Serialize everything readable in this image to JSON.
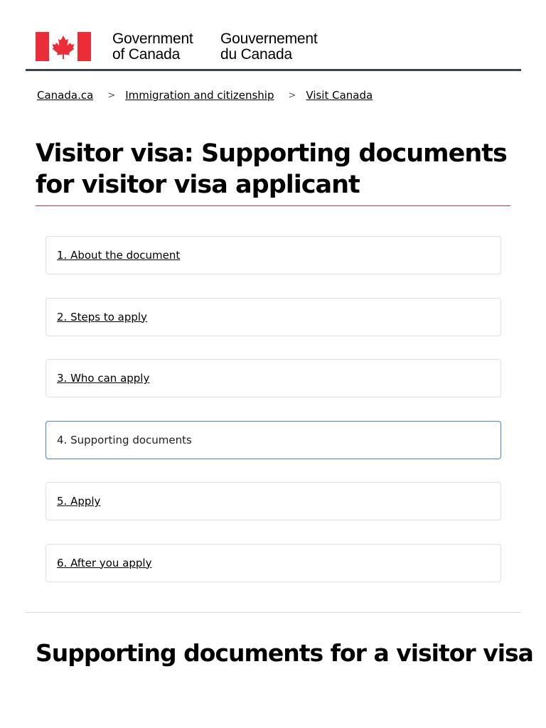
{
  "header": {
    "flag_icon": "canada-flag-icon",
    "signature_en_line1": "Government",
    "signature_en_line2": "of Canada",
    "signature_fr_line1": "Gouvernement",
    "signature_fr_line2": "du Canada",
    "flag_color": "#eb2d37",
    "rule_color": "#38414d"
  },
  "breadcrumb": {
    "items": [
      {
        "label": "Canada.ca"
      },
      {
        "label": "Immigration and citizenship"
      },
      {
        "label": "Visit Canada"
      }
    ],
    "separator": ">"
  },
  "page_title": "Visitor visa:  Supporting documents for visitor visa applicant",
  "steps": [
    {
      "label": "1. About the document",
      "active": false
    },
    {
      "label": "2. Steps to apply",
      "active": false
    },
    {
      "label": "3. Who can apply",
      "active": false
    },
    {
      "label": "4. Supporting documents",
      "active": true
    },
    {
      "label": "5. Apply",
      "active": false
    },
    {
      "label": "6. After you apply",
      "active": false
    }
  ],
  "section_title": "Supporting documents for a visitor visa",
  "colors": {
    "title_underline": "#c8373b",
    "active_step_border": "#4a82bf"
  }
}
